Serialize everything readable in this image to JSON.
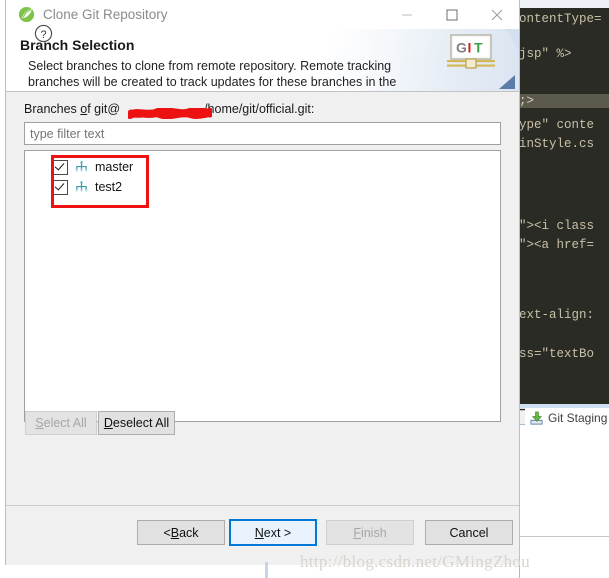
{
  "window": {
    "title": "Clone Git Repository",
    "app_icon": "eclipse-icon",
    "controls": {
      "minimize": "minimize-icon",
      "maximize": "maximize-icon",
      "close": "close-icon"
    }
  },
  "header": {
    "title": "Branch Selection",
    "description": "Select branches to clone from remote repository. Remote tracking branches will be created to track updates for these branches in the",
    "logo_text": [
      "G",
      "I",
      "T"
    ],
    "logo_colors": {
      "g": "#808080",
      "i": "#cc2222",
      "t": "#3aa34a"
    }
  },
  "main": {
    "branches_label_prefix": "Branches ",
    "branches_label_mnemonic": "o",
    "branches_label_suffix": "f git@",
    "branches_label_tail": "/home/git/official.git:",
    "filter": {
      "placeholder": "type filter text",
      "value": ""
    },
    "branches": [
      {
        "name": "master",
        "checked": true,
        "icon": "git-branch-icon"
      },
      {
        "name": "test2",
        "checked": true,
        "icon": "git-branch-icon"
      }
    ],
    "select_all": {
      "label_mnemonic": "S",
      "label_rest": "elect All",
      "disabled": true
    },
    "deselect_all": {
      "label_mnemonic": "D",
      "label_rest": "eselect All",
      "disabled": false
    }
  },
  "footer": {
    "help": "help-icon",
    "buttons": [
      {
        "prefix": "< ",
        "mnemonic": "B",
        "rest": "ack",
        "state": "enabled"
      },
      {
        "prefix": "",
        "mnemonic": "N",
        "rest": "ext >",
        "state": "default"
      },
      {
        "prefix": "",
        "mnemonic": "F",
        "rest": "inish",
        "state": "disabled"
      },
      {
        "prefix": "",
        "mnemonic": "",
        "rest": "Cancel",
        "state": "enabled"
      }
    ]
  },
  "background": {
    "code_lines": [
      "ontentType=",
      "jsp\" %>",
      ";>",
      "ype\" conte",
      "inStyle.cs",
      "\"><i class",
      "\"><a href=",
      "ext-align:",
      "ss=\"textBo"
    ],
    "git_staging_tab": "Git Staging"
  },
  "watermark": "http://blog.csdn.net/GMingZhou",
  "colors": {
    "accent_blue": "#0078d7",
    "annotation_red": "#ee1111",
    "dialog_bg": "#f0f0f0",
    "editor_bg": "#2b2b25"
  }
}
